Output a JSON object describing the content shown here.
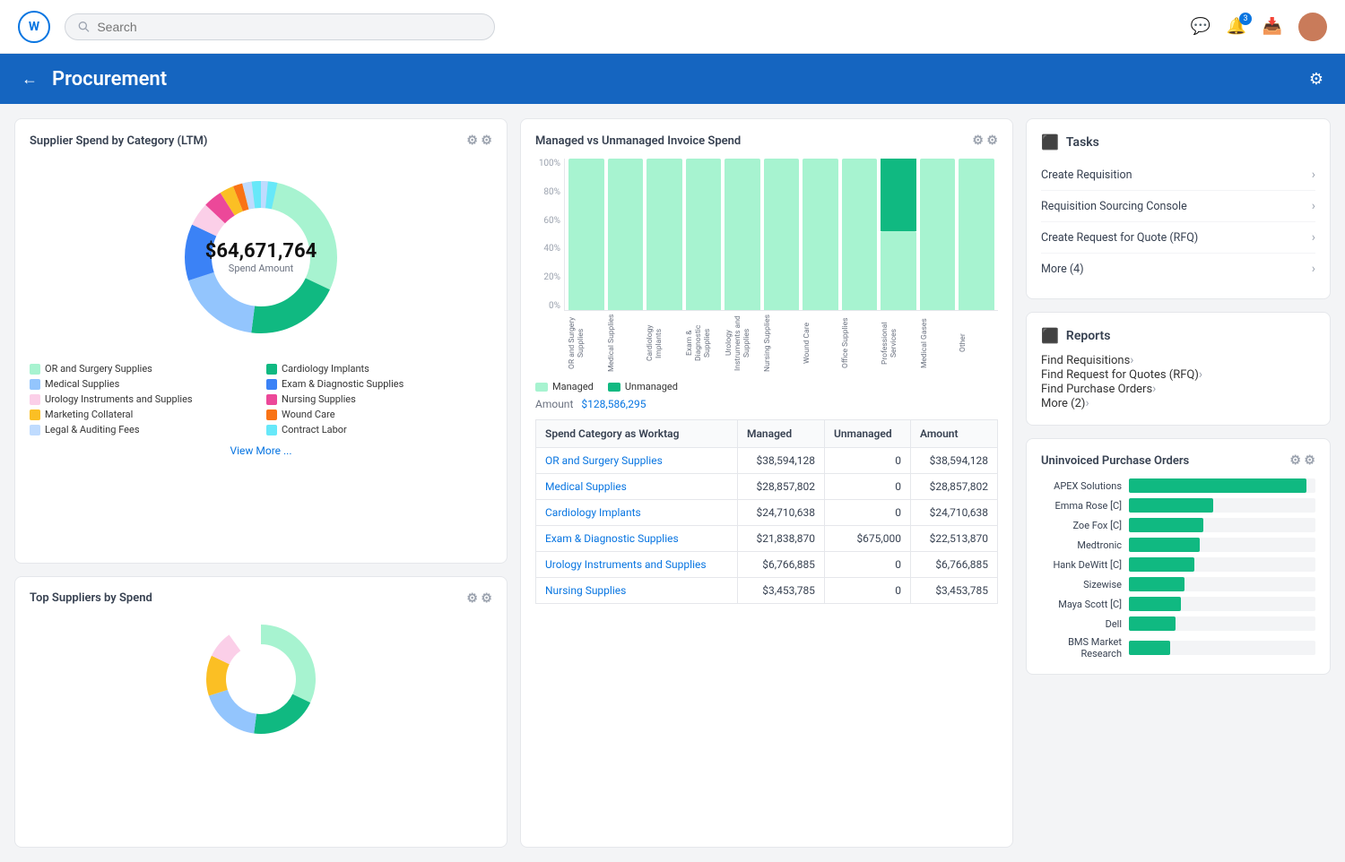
{
  "nav": {
    "logo": "W",
    "search_placeholder": "Search",
    "badge_count": "3"
  },
  "header": {
    "title": "Procurement",
    "back_label": "←"
  },
  "supplier_spend": {
    "title": "Supplier Spend by Category (LTM)",
    "amount": "$64,671,764",
    "amount_label": "Spend Amount",
    "view_more": "View More ...",
    "legend": [
      {
        "label": "OR and Surgery Supplies",
        "color": "#a7f3d0"
      },
      {
        "label": "Cardiology Implants",
        "color": "#10b981"
      },
      {
        "label": "Medical Supplies",
        "color": "#93c5fd"
      },
      {
        "label": "Exam & Diagnostic Supplies",
        "color": "#3b82f6"
      },
      {
        "label": "Urology Instruments and Supplies",
        "color": "#fbcfe8"
      },
      {
        "label": "Nursing Supplies",
        "color": "#ec4899"
      },
      {
        "label": "Marketing Collateral",
        "color": "#fbbf24"
      },
      {
        "label": "Wound Care",
        "color": "#f97316"
      },
      {
        "label": "Legal & Auditing Fees",
        "color": "#bfdbfe"
      },
      {
        "label": "Contract Labor",
        "color": "#67e8f9"
      }
    ],
    "donut_segments": [
      {
        "color": "#a7f3d0",
        "pct": 32
      },
      {
        "color": "#10b981",
        "pct": 20
      },
      {
        "color": "#93c5fd",
        "pct": 18
      },
      {
        "color": "#3b82f6",
        "pct": 12
      },
      {
        "color": "#fbcfe8",
        "pct": 5
      },
      {
        "color": "#ec4899",
        "pct": 4
      },
      {
        "color": "#fbbf24",
        "pct": 3
      },
      {
        "color": "#f97316",
        "pct": 2
      },
      {
        "color": "#bfdbfe",
        "pct": 2
      },
      {
        "color": "#67e8f9",
        "pct": 2
      }
    ]
  },
  "managed_spend": {
    "title": "Managed vs Unmanaged Invoice Spend",
    "y_labels": [
      "0%",
      "20%",
      "40%",
      "60%",
      "80%",
      "100%"
    ],
    "bars": [
      {
        "label": "OR and Surgery Supplies",
        "managed": 100,
        "unmanaged": 0
      },
      {
        "label": "Medical Supplies",
        "managed": 100,
        "unmanaged": 0
      },
      {
        "label": "Cardiology Implants",
        "managed": 100,
        "unmanaged": 0
      },
      {
        "label": "Exam & Diagnostic Supplies",
        "managed": 100,
        "unmanaged": 0
      },
      {
        "label": "Urology Instruments and Supplies",
        "managed": 100,
        "unmanaged": 0
      },
      {
        "label": "Nursing Supplies",
        "managed": 100,
        "unmanaged": 0
      },
      {
        "label": "Wound Care",
        "managed": 100,
        "unmanaged": 0
      },
      {
        "label": "Office Supplies",
        "managed": 100,
        "unmanaged": 0
      },
      {
        "label": "Professional Services",
        "managed": 52,
        "unmanaged": 48
      },
      {
        "label": "Medical Gases",
        "managed": 100,
        "unmanaged": 0
      },
      {
        "label": "Other",
        "managed": 100,
        "unmanaged": 0
      }
    ],
    "legend_managed": "Managed",
    "legend_unmanaged": "Unmanaged",
    "amount_label": "Amount",
    "amount_value": "$128,586,295"
  },
  "spend_table": {
    "headers": [
      "Spend Category as Worktag",
      "Managed",
      "Unmanaged",
      "Amount"
    ],
    "rows": [
      {
        "category": "OR and Surgery Supplies",
        "managed": "$38,594,128",
        "unmanaged": "0",
        "amount": "$38,594,128"
      },
      {
        "category": "Medical Supplies",
        "managed": "$28,857,802",
        "unmanaged": "0",
        "amount": "$28,857,802"
      },
      {
        "category": "Cardiology Implants",
        "managed": "$24,710,638",
        "unmanaged": "0",
        "amount": "$24,710,638"
      },
      {
        "category": "Exam & Diagnostic Supplies",
        "managed": "$21,838,870",
        "unmanaged": "$675,000",
        "amount": "$22,513,870"
      },
      {
        "category": "Urology Instruments and Supplies",
        "managed": "$6,766,885",
        "unmanaged": "0",
        "amount": "$6,766,885"
      },
      {
        "category": "Nursing Supplies",
        "managed": "$3,453,785",
        "unmanaged": "0",
        "amount": "$3,453,785"
      }
    ]
  },
  "tasks": {
    "section_title": "Tasks",
    "items": [
      {
        "label": "Create Requisition"
      },
      {
        "label": "Requisition Sourcing Console"
      },
      {
        "label": "Create Request for Quote (RFQ)"
      },
      {
        "label": "More (4)"
      }
    ]
  },
  "reports": {
    "section_title": "Reports",
    "items": [
      {
        "label": "Find Requisitions"
      },
      {
        "label": "Find Request for Quotes (RFQ)"
      },
      {
        "label": "Find Purchase Orders"
      },
      {
        "label": "More (2)"
      }
    ]
  },
  "uninvoiced_po": {
    "title": "Uninvoiced Purchase Orders",
    "bars": [
      {
        "label": "APEX Solutions",
        "pct": 95
      },
      {
        "label": "Emma Rose [C]",
        "pct": 45
      },
      {
        "label": "Zoe Fox [C]",
        "pct": 40
      },
      {
        "label": "Medtronic",
        "pct": 38
      },
      {
        "label": "Hank DeWitt [C]",
        "pct": 35
      },
      {
        "label": "Sizewise",
        "pct": 30
      },
      {
        "label": "Maya Scott [C]",
        "pct": 28
      },
      {
        "label": "Dell",
        "pct": 25
      },
      {
        "label": "BMS Market Research",
        "pct": 22
      }
    ]
  },
  "top_suppliers": {
    "title": "Top Suppliers by Spend"
  }
}
